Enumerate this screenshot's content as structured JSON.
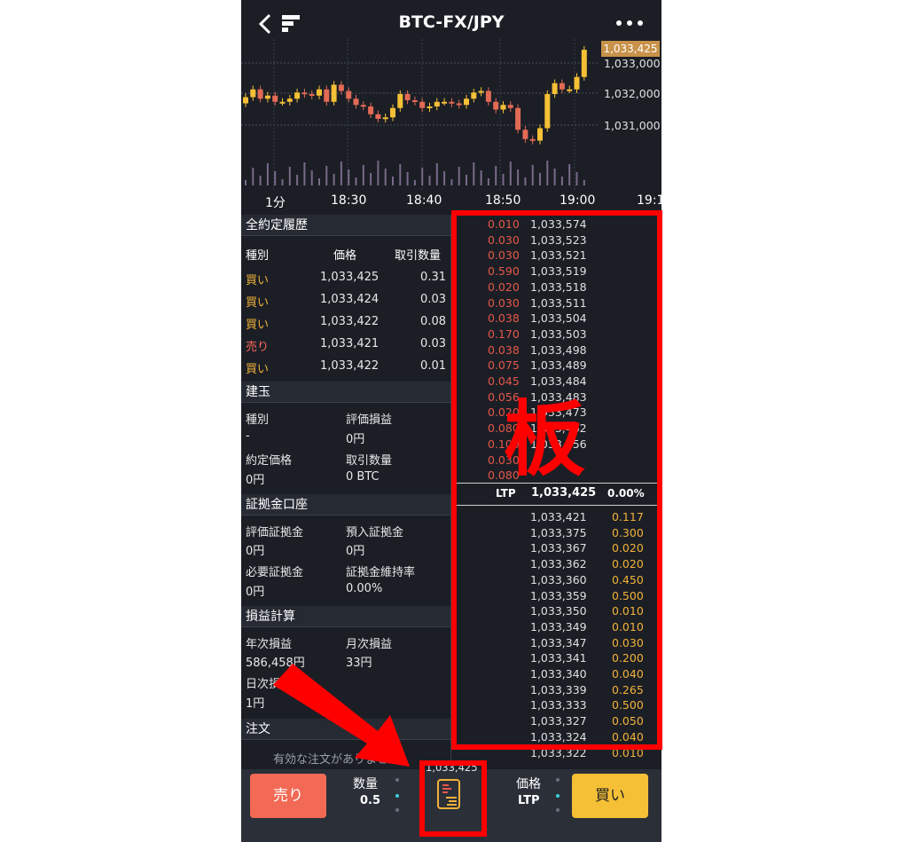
{
  "header": {
    "title": "BTC-FX/JPY",
    "back_icon": "chevron-left-icon",
    "logo_icon": "bitflyer-logo-icon",
    "more_icon": "more-dots-icon"
  },
  "chart": {
    "current_price_tag": "1,033,425",
    "price_labels": [
      "1,033,000",
      "1,032,000",
      "1,031,000"
    ],
    "time_labels": [
      "1分",
      "18:30",
      "18:40",
      "18:50",
      "19:00",
      "19:1"
    ]
  },
  "trades": {
    "section_title": "全約定履歴",
    "headers": [
      "種別",
      "価格",
      "取引数量"
    ],
    "rows": [
      {
        "side": "買い",
        "price": "1,033,425",
        "qty": "0.31"
      },
      {
        "side": "買い",
        "price": "1,033,424",
        "qty": "0.03"
      },
      {
        "side": "買い",
        "price": "1,033,422",
        "qty": "0.08"
      },
      {
        "side": "売り",
        "price": "1,033,421",
        "qty": "0.03"
      },
      {
        "side": "買い",
        "price": "1,033,422",
        "qty": "0.01"
      }
    ]
  },
  "position": {
    "section_title": "建玉",
    "type_label": "種別",
    "type_value": "-",
    "pnl_label": "評価損益",
    "pnl_value": "0円",
    "price_label": "約定価格",
    "price_value": "0円",
    "qty_label": "取引数量",
    "qty_value": "0 BTC"
  },
  "margin": {
    "section_title": "証拠金口座",
    "eval_label": "評価証拠金",
    "eval_value": "0円",
    "deposit_label": "預入証拠金",
    "deposit_value": "0円",
    "required_label": "必要証拠金",
    "required_value": "0円",
    "ratio_label": "証拠金維持率",
    "ratio_value": "0.00%"
  },
  "pnl": {
    "section_title": "損益計算",
    "year_label": "年次損益",
    "year_value": "586,458円",
    "month_label": "月次損益",
    "month_value": "33円",
    "day_label": "日次損益",
    "day_label_visible": "日次損",
    "day_value": "1円"
  },
  "orders": {
    "section_title": "注文",
    "empty_text": "有効な注文がありません"
  },
  "orderbook": {
    "asks": [
      {
        "size": "0.010",
        "price": "1,033,574"
      },
      {
        "size": "0.030",
        "price": "1,033,523"
      },
      {
        "size": "0.030",
        "price": "1,033,521"
      },
      {
        "size": "0.590",
        "price": "1,033,519"
      },
      {
        "size": "0.020",
        "price": "1,033,518"
      },
      {
        "size": "0.030",
        "price": "1,033,511"
      },
      {
        "size": "0.038",
        "price": "1,033,504"
      },
      {
        "size": "0.170",
        "price": "1,033,503"
      },
      {
        "size": "0.038",
        "price": "1,033,498"
      },
      {
        "size": "0.075",
        "price": "1,033,489"
      },
      {
        "size": "0.045",
        "price": "1,033,484"
      },
      {
        "size": "0.056",
        "price": "1,033,483"
      },
      {
        "size": "0.020",
        "price": "1,033,473"
      },
      {
        "size": "0.080",
        "price": "1,033,462"
      },
      {
        "size": "0.100",
        "price": "1,033,456"
      },
      {
        "size": "0.030",
        "price": ""
      },
      {
        "size": "0.080",
        "price": ""
      }
    ],
    "ltp_label": "LTP",
    "ltp_price": "1,033,425",
    "ltp_change": "0.00%",
    "bids": [
      {
        "price": "1,033,421",
        "size": "0.117"
      },
      {
        "price": "1,033,375",
        "size": "0.300"
      },
      {
        "price": "1,033,367",
        "size": "0.020"
      },
      {
        "price": "1,033,362",
        "size": "0.020"
      },
      {
        "price": "1,033,360",
        "size": "0.450"
      },
      {
        "price": "1,033,359",
        "size": "0.500"
      },
      {
        "price": "1,033,350",
        "size": "0.010"
      },
      {
        "price": "1,033,349",
        "size": "0.010"
      },
      {
        "price": "1,033,347",
        "size": "0.030"
      },
      {
        "price": "1,033,341",
        "size": "0.200"
      },
      {
        "price": "1,033,340",
        "size": "0.040"
      },
      {
        "price": "1,033,339",
        "size": "0.265"
      },
      {
        "price": "1,033,333",
        "size": "0.500"
      },
      {
        "price": "1,033,327",
        "size": "0.050"
      },
      {
        "price": "1,033,324",
        "size": "0.040"
      },
      {
        "price": "1,033,322",
        "size": "0.010"
      }
    ]
  },
  "bottom_bar": {
    "sell_label": "売り",
    "qty_label": "数量",
    "qty_value": "0.5",
    "price_tag": "1,033,425",
    "book_icon": "order-book-icon",
    "price_label": "価格",
    "price_value": "LTP",
    "buy_label": "買い"
  },
  "annotation": {
    "board_label": "板",
    "colors": {
      "annotation": "#ff0000",
      "buy": "#f2b23a",
      "sell": "#ff6a5c"
    }
  }
}
